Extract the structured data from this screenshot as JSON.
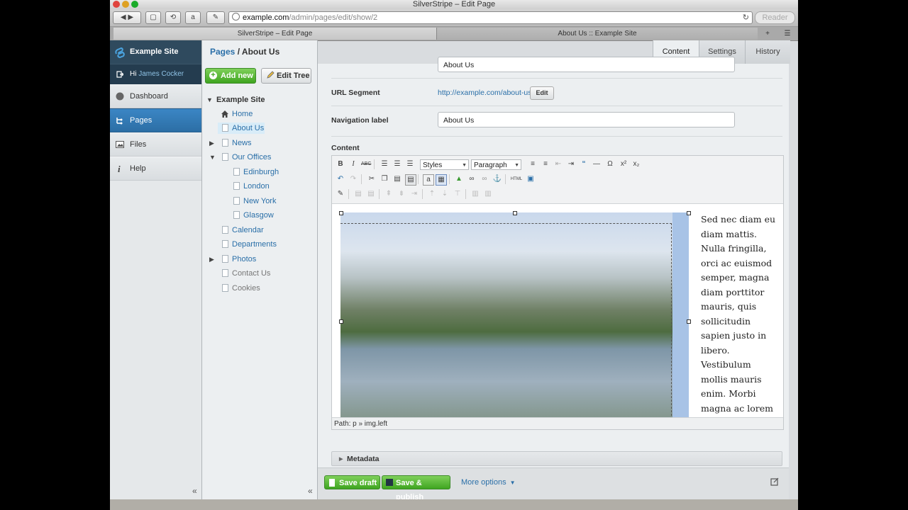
{
  "browser": {
    "window_title": "SilverStripe – Edit Page",
    "url_host": "example.com",
    "url_path": "/admin/pages/edit/show/2",
    "reader_label": "Reader",
    "tabs": [
      {
        "label": "SilverStripe – Edit Page",
        "active": true
      },
      {
        "label": "About Us :: Example Site",
        "active": false
      }
    ],
    "new_tab_label": "+"
  },
  "cms": {
    "site_name": "Example Site",
    "greeting": "Hi ",
    "user_name": "James Cocker",
    "menu": [
      {
        "label": "Dashboard",
        "active": false
      },
      {
        "label": "Pages",
        "active": true
      },
      {
        "label": "Files",
        "active": false
      },
      {
        "label": "Help",
        "active": false
      }
    ],
    "collapse_glyph": "«"
  },
  "breadcrumb": {
    "section": "Pages",
    "separator": " / ",
    "page": "About Us"
  },
  "tree_actions": {
    "add_new": "Add new",
    "edit_tree": "Edit Tree"
  },
  "tree": {
    "root": "Example Site",
    "nodes": [
      {
        "label": "Home",
        "depth": 1,
        "icon": "home-icon",
        "toggle": ""
      },
      {
        "label": "About Us",
        "depth": 1,
        "icon": "page-icon",
        "toggle": "",
        "selected": true
      },
      {
        "label": "News",
        "depth": 1,
        "icon": "page-icon",
        "toggle": "▶"
      },
      {
        "label": "Our Offices",
        "depth": 1,
        "icon": "page-icon",
        "toggle": "▼"
      },
      {
        "label": "Edinburgh",
        "depth": 2,
        "icon": "page-icon",
        "toggle": ""
      },
      {
        "label": "London",
        "depth": 2,
        "icon": "page-icon",
        "toggle": ""
      },
      {
        "label": "New York",
        "depth": 2,
        "icon": "page-icon",
        "toggle": ""
      },
      {
        "label": "Glasgow",
        "depth": 2,
        "icon": "page-icon",
        "toggle": ""
      },
      {
        "label": "Calendar",
        "depth": 1,
        "icon": "page-icon",
        "toggle": ""
      },
      {
        "label": "Departments",
        "depth": 1,
        "icon": "page-icon",
        "toggle": ""
      },
      {
        "label": "Photos",
        "depth": 1,
        "icon": "page-icon",
        "toggle": "▶"
      },
      {
        "label": "Contact Us",
        "depth": 1,
        "icon": "page-icon",
        "toggle": "",
        "muted": true
      },
      {
        "label": "Cookies",
        "depth": 1,
        "icon": "page-icon",
        "toggle": "",
        "muted": true
      }
    ]
  },
  "edit_tabs": [
    {
      "label": "Content",
      "active": true
    },
    {
      "label": "Settings",
      "active": false
    },
    {
      "label": "History",
      "active": false
    }
  ],
  "form": {
    "title_value": "About Us",
    "url_segment_label": "URL Segment",
    "url_segment_value": "http://example.com/about-us",
    "edit_button": "Edit",
    "nav_label": "Navigation label",
    "nav_value": "About Us",
    "content_label": "Content",
    "styles_select": "Styles",
    "format_select": "Paragraph",
    "body_text": "Sed nec diam eu diam mattis. Nulla fringilla, orci ac euismod semper, magna diam porttitor mauris, quis sollicitudin sapien justo in libero. Vestibulum mollis mauris enim. Morbi magna ac lorem rutrum",
    "path": "Path: p » img.left",
    "metadata_label": "Metadata"
  },
  "actions": {
    "save_draft": "Save draft",
    "save_publish": "Save & publish",
    "more_options": "More options"
  },
  "colors": {
    "brand_dark": "#2f4a5e",
    "active_blue": "#2c6ea5",
    "action_green": "#3fa520",
    "link_blue": "#2a6fa8"
  }
}
